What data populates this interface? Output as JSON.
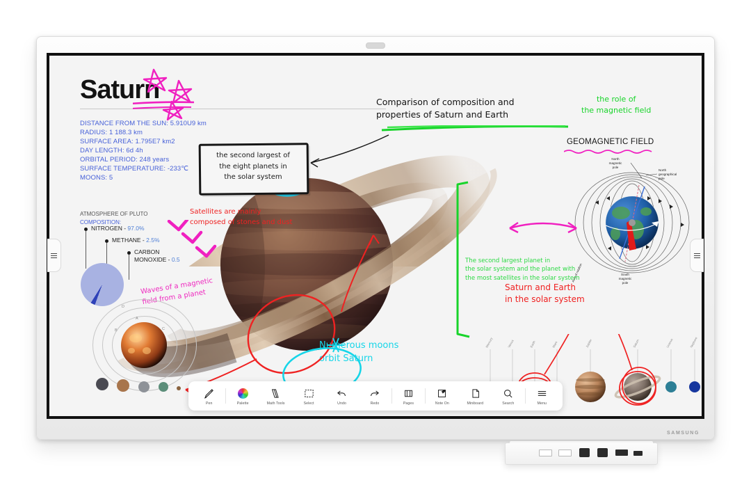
{
  "device": {
    "brand": "SAMSUNG",
    "webcam": "camera-module"
  },
  "board": {
    "title": "Saturn",
    "stats": [
      {
        "label": "DISTANCE FROM THE SUN:",
        "value": "5.910U9 km"
      },
      {
        "label": "RADIUS:",
        "value": "1 188.3 km"
      },
      {
        "label": "SURFACE AREA:",
        "value": "1.795E7 km2"
      },
      {
        "label": "DAY LENGTH:",
        "value": "6d 4h"
      },
      {
        "label": "ORBITAL PERIOD:",
        "value": "248 years"
      },
      {
        "label": "SURFACE TEMPERATURE:",
        "value": "-233℃"
      },
      {
        "label": "MOONS:",
        "value": "5"
      }
    ],
    "atmosphere": {
      "heading_line1": "ATMOSPHERE OF PLUTO",
      "heading_line2": "COMPOSITION:",
      "items": [
        {
          "name": "NITROGEN - ",
          "value": "97.0%"
        },
        {
          "name": "METHANE - ",
          "value": "2.5%"
        },
        {
          "name": "CARBON\nMONOXIDE - ",
          "value": "0.5"
        }
      ]
    },
    "note_box": "the second largest of\nthe eight planets in\nthe solar system",
    "headline_handwritten": "Comparison of composition and\nproperties of Saturn and Earth",
    "green_role": "the role of\nthe magnetic field",
    "geomagnetic_heading": "GEOMAGNETIC FIELD",
    "earth_diagram": {
      "north_magnetic_pole": "North\nmagnetic\npole",
      "north_geographical_pole": "North\ngeographical\npole",
      "south_magnetic_pole": "South\nmagnetic\npole",
      "axis_of_rotation": "Axis of rotation"
    },
    "annotations": {
      "red_satellites": "Satellites are mainly\ncomposed of stones and dust",
      "pink_waves": "Waves of a magnetic\nfield from a planet",
      "green_second": "The second largest planet in\nthe solar system and the planet with\nthe most satellites in the solar system",
      "red_saturn_earth": "Saturn and Earth\nin the solar system",
      "cyan_moons": "Numerous moons\norbit Saturn"
    },
    "planet_row": [
      "Mercury",
      "Venus",
      "Earth",
      "Mars",
      "Jupiter",
      "Saturn",
      "Uranus",
      "Neptune"
    ],
    "orbit_labels": [
      "D",
      "A",
      "C",
      "B"
    ]
  },
  "toolbar": {
    "items": [
      {
        "label": "Pen",
        "icon": "pen-icon"
      },
      {
        "label": "Palette",
        "icon": "palette-icon"
      },
      {
        "label": "Math Tools",
        "icon": "math-tools-icon"
      },
      {
        "label": "Select",
        "icon": "select-icon"
      },
      {
        "label": "Undo",
        "icon": "undo-icon"
      },
      {
        "label": "Redo",
        "icon": "redo-icon"
      },
      {
        "label": "Pages",
        "icon": "pages-icon"
      },
      {
        "label": "Note On",
        "icon": "note-on-icon"
      },
      {
        "label": "Miniboard",
        "icon": "miniboard-icon"
      },
      {
        "label": "Search",
        "icon": "search-icon"
      },
      {
        "label": "Menu",
        "icon": "menu-icon"
      }
    ]
  },
  "stand": {
    "ports": [
      "USB",
      "USB",
      "LAN",
      "LAN",
      "HDMI",
      "SERVICE"
    ]
  },
  "colors": {
    "stat_blue": "#4660d8",
    "pink": "#ef2bc0",
    "red": "#ef2222",
    "green": "#18d42a",
    "cyan": "#16d5e8"
  }
}
